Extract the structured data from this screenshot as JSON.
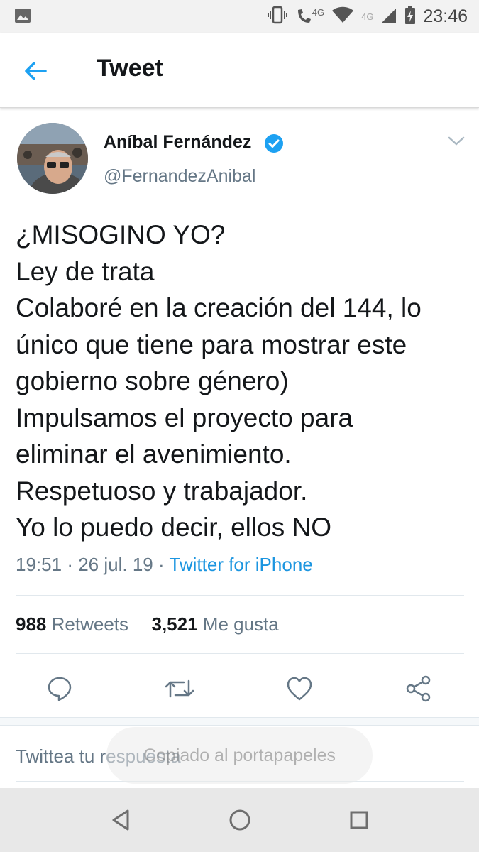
{
  "status_bar": {
    "time": "23:46",
    "network_primary": "4G",
    "network_secondary": "4G",
    "icons": [
      "image-icon",
      "vibrate-icon",
      "call-icon",
      "wifi-icon",
      "signal-icon",
      "battery-charging-icon"
    ]
  },
  "header": {
    "title": "Tweet",
    "back_icon": "arrow-left-icon"
  },
  "tweet": {
    "author_name": "Aníbal Fernández",
    "author_handle": "@FernandezAnibal",
    "verified": true,
    "lines": [
      "¿MISOGINO YO?",
      "Ley de trata",
      "Colaboré en la creación del 144, lo",
      "único que tiene para mostrar este",
      "gobierno sobre género)",
      "Impulsamos el proyecto para",
      "eliminar el avenimiento.",
      "Respetuoso y trabajador.",
      "Yo lo puedo decir, ellos NO"
    ],
    "time": "19:51",
    "date": "26 jul. 19",
    "separator": "·",
    "source": "Twitter for iPhone",
    "retweets_count": "988",
    "retweets_label": "Retweets",
    "likes_count": "3,521",
    "likes_label": "Me gusta"
  },
  "actions": [
    "reply-icon",
    "retweet-icon",
    "like-icon",
    "share-icon"
  ],
  "reply": {
    "placeholder": "Twittea tu respuesta"
  },
  "toast": "Copiado al portapapeles",
  "colors": {
    "accent": "#1da1f2",
    "link": "#1b95e0",
    "secondary_text": "#657786",
    "primary_text": "#14171a"
  }
}
